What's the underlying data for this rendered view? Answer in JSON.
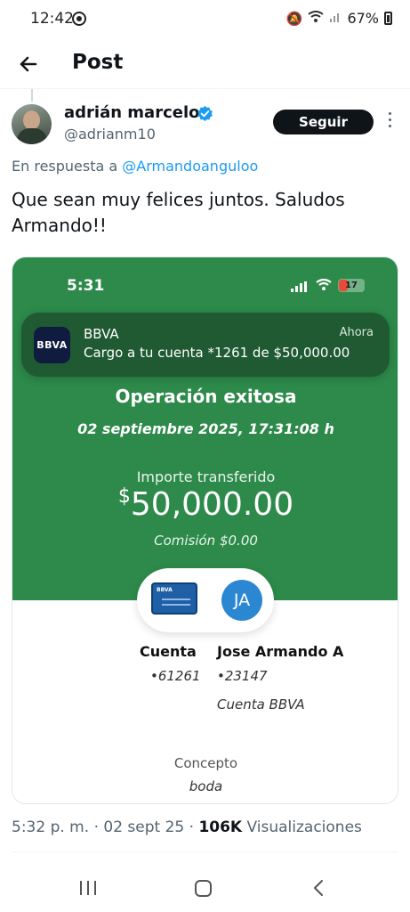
{
  "status_bar": {
    "time": "12:42",
    "battery": "67%"
  },
  "topbar": {
    "title": "Post"
  },
  "post": {
    "display_name": "adrián marcelo",
    "handle": "@adrianm10",
    "follow_label": "Seguir",
    "reply_prefix": "En respuesta a",
    "reply_handle": "@Armandoanguloo",
    "text": "Que sean muy felices juntos. Saludos Armando!!",
    "time": "5:32 p. m.",
    "date": "02 sept 25",
    "views_count": "106K",
    "views_label": "Visualizaciones"
  },
  "media": {
    "time": "5:31",
    "battery": "17",
    "notification": {
      "logo": "BBVA",
      "title": "BBVA",
      "time": "Ahora",
      "body": "Cargo a tu cuenta *1261 de $50,000.00"
    },
    "op_title": "Operación exitosa",
    "op_date": "02 septiembre 2025, 17:31:08 h",
    "amount_label": "Importe transferido",
    "amount_currency": "$",
    "amount_value": "50,000.00",
    "commission": "Comisión  $0.00",
    "card_brand": "BBVA",
    "dest_initials": "JA",
    "account_label": "Cuenta",
    "account_number": "•61261",
    "dest_name": "Jose Armando A",
    "dest_number": "•23147",
    "dest_bank": "Cuenta BBVA",
    "concept_label": "Concepto",
    "concept_value": "boda"
  },
  "colors": {
    "accent": "#1d9bf0",
    "bbva_green": "#2d8a4a",
    "verified": "#1d9bf0"
  },
  "icons": {
    "back": "arrow-left-icon",
    "verified": "verified-badge-icon",
    "more": "more-vertical-icon",
    "nav_recent": "recent-apps-icon",
    "nav_home": "home-icon",
    "nav_back": "nav-back-icon"
  }
}
